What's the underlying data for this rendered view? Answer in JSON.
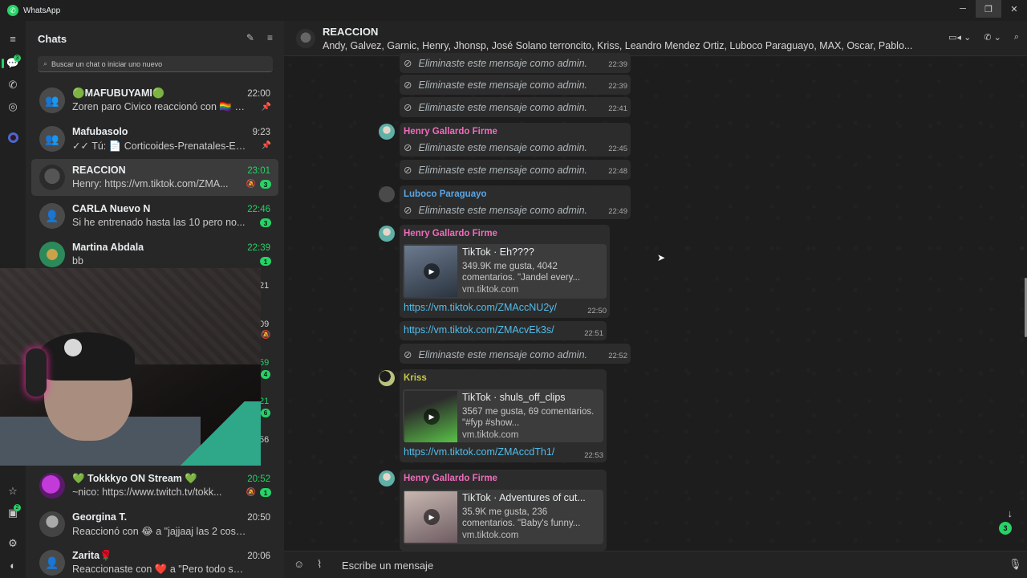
{
  "window": {
    "title": "WhatsApp",
    "controls": {
      "minimize": "─",
      "restore": "❐",
      "close": "✕"
    }
  },
  "rail": {
    "chats_badge": "3",
    "status_badge": "2",
    "icons": [
      "menu-icon",
      "chats-icon",
      "calls-icon",
      "status-icon",
      "meta-ai-icon",
      "starred-icon",
      "archived-icon",
      "settings-icon",
      "profile-icon"
    ]
  },
  "chat_list": {
    "title": "Chats",
    "search_placeholder": "Buscar un chat o iniciar uno nuevo",
    "items": [
      {
        "name": "🟢MAFUBUYAMI🟢",
        "preview": "Zoren paro Civico reaccionó con 🏳️‍🌈 a ...",
        "time": "22:00",
        "time_color": "normal",
        "pinned": true,
        "muted": false,
        "count": ""
      },
      {
        "name": "Mafubasolo",
        "preview": "✓✓ Tú: 📄 Corticoides-Prenatales-Eje-...",
        "time": "9:23",
        "time_color": "normal",
        "pinned": true,
        "muted": false,
        "count": ""
      },
      {
        "name": "REACCION",
        "preview": "Henry: https://vm.tiktok.com/ZMA...",
        "time": "23:01",
        "time_color": "green",
        "pinned": false,
        "muted": true,
        "count": "3"
      },
      {
        "name": "CARLA Nuevo N",
        "preview": "Si he entrenado hasta las 10 pero no...",
        "time": "22:46",
        "time_color": "green",
        "pinned": false,
        "muted": false,
        "count": "3"
      },
      {
        "name": "Martina Abdala",
        "preview": "bb",
        "time": "22:39",
        "time_color": "green",
        "pinned": false,
        "muted": false,
        "count": "1"
      },
      {
        "name": "💚 Tokkkyo ON Stream 💚",
        "preview": "~nico: https://www.twitch.tv/tokk...",
        "time": "20:52",
        "time_color": "green",
        "pinned": false,
        "muted": true,
        "count": "1"
      },
      {
        "name": "Georgina T.",
        "preview": "Reaccionó con 😂 a \"jajjaaj las 2 cosas ...",
        "time": "20:50",
        "time_color": "normal",
        "pinned": false,
        "muted": false,
        "count": ""
      },
      {
        "name": "Zarita🌹",
        "preview": "Reaccionaste con ❤️ a \"Pero todo sali...",
        "time": "20:06",
        "time_color": "normal",
        "pinned": false,
        "muted": false,
        "count": ""
      }
    ],
    "hidden_partial": {
      "t1": "21",
      "t2": "09",
      "t3": "59",
      "b3": "4",
      "t4": "21",
      "b4": "6",
      "t5": "56"
    }
  },
  "conversation": {
    "group_name": "REACCION",
    "members": "Andy, Galvez, Garnic, Henry, Jhonsp, José Solano terroncito, Kriss, Leandro Mendez Ortiz, Luboco Paraguayo, MAX, Oscar, Pablo...",
    "deleted_text": "Eliminaste este mensaje como admin.",
    "messages": {
      "d1_time": "22:39",
      "d2_time": "22:39",
      "d3_time": "22:41",
      "henry1_sender": "Henry Gallardo Firme",
      "henry1_d1_time": "22:45",
      "henry1_d2_time": "22:48",
      "luboco_sender": "Luboco Paraguayo",
      "luboco_time": "22:49",
      "henry2_sender": "Henry Gallardo Firme",
      "henry2_card_title": "TikTok · Eh????",
      "henry2_card_desc": "349.9K me gusta, 4042 comentarios. \"Jandel every...",
      "henry2_card_domain": "vm.tiktok.com",
      "henry2_link": "https://vm.tiktok.com/ZMAccNU2y/",
      "henry2_time": "22:50",
      "henry3_link": "https://vm.tiktok.com/ZMAcvEk3s/",
      "henry3_time": "22:51",
      "henry4_time": "22:52",
      "kriss_sender": "Kriss",
      "kriss_card_title": "TikTok · shuls_off_clips",
      "kriss_card_desc": "3567 me gusta, 69 comentarios. \"#fyp #show...",
      "kriss_card_domain": "vm.tiktok.com",
      "kriss_link": "https://vm.tiktok.com/ZMAccdTh1/",
      "kriss_time": "22:53",
      "henry5_sender": "Henry Gallardo Firme",
      "henry5_card_title": "TikTok · Adventures of cut...",
      "henry5_card_desc": "35.9K me gusta, 236 comentarios. \"Baby's funny...",
      "henry5_card_domain": "vm.tiktok.com"
    },
    "unread_scroll_count": "3",
    "compose_placeholder": "Escribe un mensaje"
  },
  "colors": {
    "accent": "#25d366",
    "link": "#53bdeb",
    "sender_pink": "#f06bbd",
    "sender_blue": "#5aa6e6",
    "sender_yellow": "#c8c84a"
  }
}
